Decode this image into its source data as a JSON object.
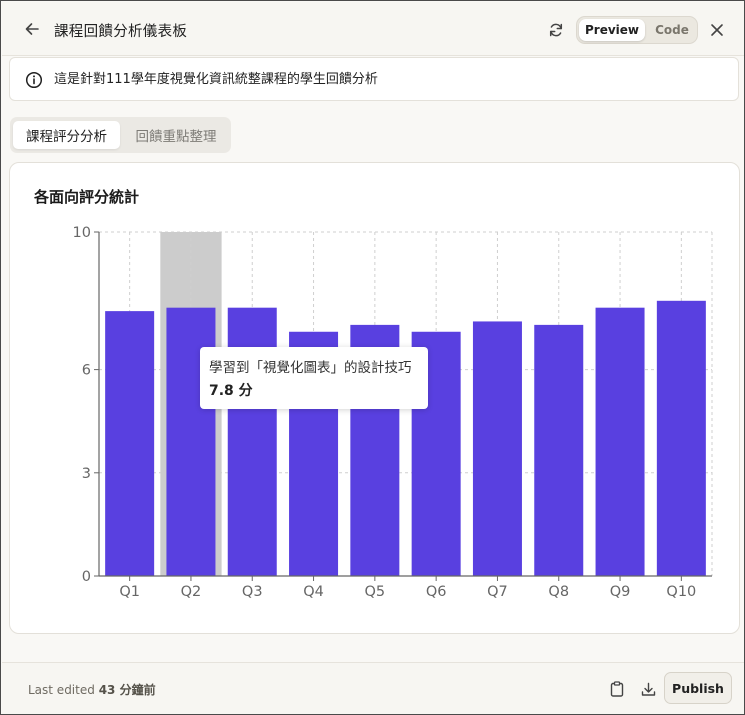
{
  "header": {
    "title": "課程回饋分析儀表板",
    "toggle_preview": "Preview",
    "toggle_code": "Code",
    "icons": {
      "back": "arrow-left-icon",
      "refresh": "refresh-icon",
      "close": "close-icon"
    }
  },
  "banner": {
    "icon": "info-icon",
    "text": "這是針對111學年度視覺化資訊統整課程的學生回饋分析"
  },
  "tabs": [
    {
      "label": "課程評分分析",
      "active": true
    },
    {
      "label": "回饋重點整理",
      "active": false
    }
  ],
  "card": {
    "title": "各面向評分統計"
  },
  "tooltip": {
    "title": "學習到「視覺化圖表」的設計技巧",
    "value": "7.8 分"
  },
  "chart_data": {
    "type": "bar",
    "categories": [
      "Q1",
      "Q2",
      "Q3",
      "Q4",
      "Q5",
      "Q6",
      "Q7",
      "Q8",
      "Q9",
      "Q10"
    ],
    "values": [
      7.7,
      7.8,
      7.8,
      7.1,
      7.3,
      7.1,
      7.4,
      7.3,
      7.8,
      8.0
    ],
    "ylim": [
      0,
      10
    ],
    "yticks": [
      "0",
      "3",
      "6",
      "10"
    ],
    "highlighted_category": "Q2",
    "grid": true,
    "bar_color": "#5940e0",
    "highlight_color": "#cccccc"
  },
  "footer": {
    "last_edited_prefix": "Last edited",
    "last_edited_value": "43 分鐘前",
    "publish_label": "Publish",
    "icons": {
      "copy": "clipboard-icon",
      "download": "download-icon"
    }
  }
}
